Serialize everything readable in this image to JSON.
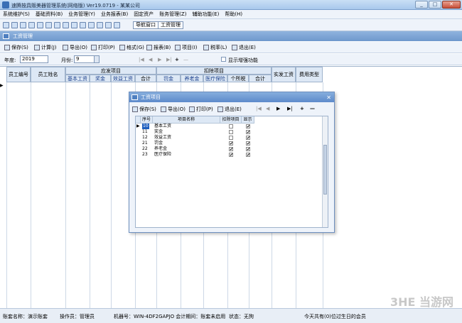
{
  "window": {
    "title": "速腾按具贩美器管理系统(网络版) Ver19.0719 - 某某公司",
    "buttons": [
      "_",
      "□",
      "✕"
    ]
  },
  "menu": [
    "系统维护(S)",
    "基础资料(B)",
    "业务管理(Y)",
    "业务报表(B)",
    "固定资产",
    "账务管理(Z)",
    "辅助功能(E)",
    "帮助(H)"
  ],
  "iconbar": {
    "nav_button": "导航窗口",
    "salary_button": "工资管理"
  },
  "subtitle": "工资管理",
  "toolbar": [
    "保存(S)",
    "计算(J)",
    "导出(O)",
    "打印(P)",
    "格式(G)",
    "报表(B)",
    "项目(I)",
    "税率(L)",
    "退出(E)"
  ],
  "filters": {
    "year_label": "年度:",
    "year_value": "2019",
    "month_label": "月份:",
    "month_value": "9",
    "enhanced_label": "显示增强功能"
  },
  "grid": {
    "col_emp_no": "员工编号",
    "col_emp_name": "员工姓名",
    "group_payable": "应发项目",
    "group_deduct": "扣除项目",
    "payable_cols": [
      "基本工资",
      "奖金",
      "效益工资",
      "合计"
    ],
    "deduct_cols": [
      "罚金",
      "养老金",
      "医疗保险",
      "个所税",
      "合计"
    ],
    "col_net": "实发工资",
    "col_cost": "费用类型",
    "row_indicator": "▶"
  },
  "dialog": {
    "title": "工资项目",
    "toolbar": [
      "保存(S)",
      "导出(O)",
      "打印(P)",
      "退出(E)"
    ],
    "cols": [
      "序号",
      "项目名称",
      "扣除项目",
      "显示"
    ],
    "rows": [
      {
        "no": "10",
        "name": "基本工资",
        "deduct": false,
        "show": true
      },
      {
        "no": "11",
        "name": "奖金",
        "deduct": false,
        "show": true
      },
      {
        "no": "12",
        "name": "效益工资",
        "deduct": false,
        "show": true
      },
      {
        "no": "21",
        "name": "罚金",
        "deduct": true,
        "show": true
      },
      {
        "no": "22",
        "name": "养老金",
        "deduct": true,
        "show": true
      },
      {
        "no": "23",
        "name": "医疗保险",
        "deduct": true,
        "show": true
      }
    ]
  },
  "status": {
    "account": "账套名称：演示账套",
    "operator": "操作员：管理员",
    "machine": "机器号：WIN-4DF2GAPJO 会计期间：账套未启用",
    "state": "状态：无狗",
    "birthday": "今天共有(0)位过生日的会员"
  },
  "watermark": "3HE 当游网"
}
